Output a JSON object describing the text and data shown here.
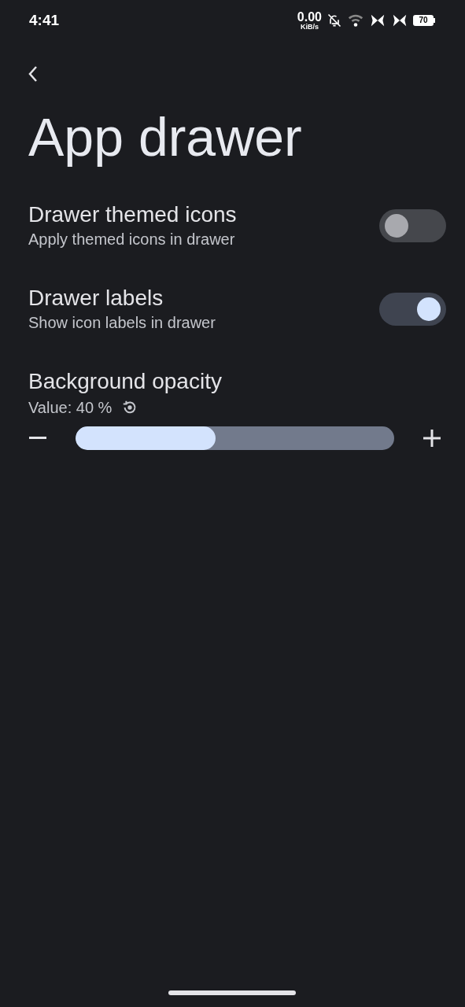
{
  "status_bar": {
    "time": "4:41",
    "net_speed": "0.00",
    "net_unit": "KiB/s",
    "battery": "70"
  },
  "title": "App drawer",
  "settings": [
    {
      "kind": "toggle",
      "title": "Drawer themed icons",
      "subtitle": "Apply themed icons in drawer",
      "on": false
    },
    {
      "kind": "toggle",
      "title": "Drawer labels",
      "subtitle": "Show icon labels in drawer",
      "on": true
    }
  ],
  "opacity": {
    "title": "Background opacity",
    "value": "Value: 40 %",
    "level": 0.44
  }
}
